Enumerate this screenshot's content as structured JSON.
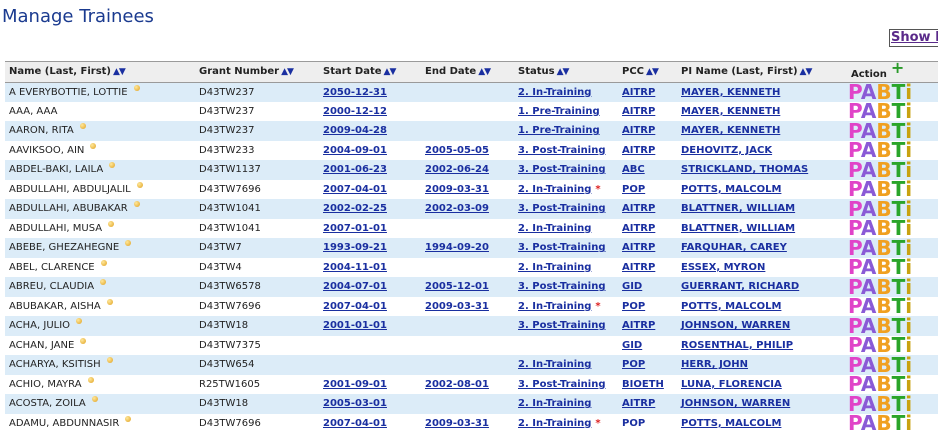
{
  "page": {
    "title": "Manage Trainees",
    "show_link": "Show F"
  },
  "colors": {
    "title": "#1a3a8f",
    "link": "#1a2fa0",
    "row_alt": "#dcecf8",
    "header_bg": "#eeeeee",
    "action_p": "#e044c8",
    "action_a": "#8a5ad6",
    "action_b": "#f0a020",
    "action_t": "#2aa52a"
  },
  "table": {
    "headers": {
      "name": "Name (Last, First)",
      "grant": "Grant Number",
      "start": "Start Date",
      "end": "End Date",
      "status": "Status",
      "pcc": "PCC",
      "pi": "PI Name (Last, First)",
      "action": "Action"
    },
    "sort_icons": {
      "asc": "▲",
      "desc": "▼"
    },
    "add_icon": "+",
    "action_letters": [
      "P",
      "A",
      "B",
      "T",
      "i"
    ],
    "rows": [
      {
        "name": "A EVERYBOTTIE, LOTTIE",
        "dot": true,
        "grant": "D43TW237",
        "start": "2050-12-31",
        "end": "",
        "status": "2. In-Training",
        "star": false,
        "pcc": "AITRP",
        "pcc_link": true,
        "pi": "MAYER, KENNETH"
      },
      {
        "name": "AAA, AAA",
        "dot": false,
        "grant": "D43TW237",
        "start": "2000-12-12",
        "end": "",
        "status": "1. Pre-Training",
        "star": false,
        "pcc": "AITRP",
        "pcc_link": true,
        "pi": "MAYER, KENNETH"
      },
      {
        "name": "AARON, RITA",
        "dot": true,
        "grant": "D43TW237",
        "start": "2009-04-28",
        "end": "",
        "status": "1. Pre-Training",
        "star": false,
        "pcc": "AITRP",
        "pcc_link": true,
        "pi": "MAYER, KENNETH"
      },
      {
        "name": "AAVIKSOO, AIN",
        "dot": true,
        "grant": "D43TW233",
        "start": "2004-09-01",
        "end": "2005-05-05",
        "status": "3. Post-Training",
        "star": false,
        "pcc": "AITRP",
        "pcc_link": true,
        "pi": "DEHOVITZ, JACK"
      },
      {
        "name": "ABDEL-BAKI, LAILA",
        "dot": true,
        "grant": "D43TW1137",
        "start": "2001-06-23",
        "end": "2002-06-24",
        "status": "3. Post-Training",
        "star": false,
        "pcc": "ABC",
        "pcc_link": true,
        "pi": "STRICKLAND, THOMAS"
      },
      {
        "name": "ABDULLAHI, ABDULJALIL",
        "dot": true,
        "grant": "D43TW7696",
        "start": "2007-04-01",
        "end": "2009-03-31",
        "status": "2. In-Training",
        "star": true,
        "pcc": "POP",
        "pcc_link": true,
        "pi": "POTTS, MALCOLM"
      },
      {
        "name": "ABDULLAHI, ABUBAKAR",
        "dot": true,
        "grant": "D43TW1041",
        "start": "2002-02-25",
        "end": "2002-03-09",
        "status": "3. Post-Training",
        "star": false,
        "pcc": "AITRP",
        "pcc_link": true,
        "pi": "BLATTNER, WILLIAM"
      },
      {
        "name": "ABDULLAHI, MUSA",
        "dot": true,
        "grant": "D43TW1041",
        "start": "2007-01-01",
        "end": "",
        "status": "2. In-Training",
        "star": false,
        "pcc": "AITRP",
        "pcc_link": true,
        "pi": "BLATTNER, WILLIAM"
      },
      {
        "name": "ABEBE, GHEZAHEGNE",
        "dot": true,
        "grant": "D43TW7",
        "start": "1993-09-21",
        "end": "1994-09-20",
        "status": "3. Post-Training",
        "star": false,
        "pcc": "AITRP",
        "pcc_link": true,
        "pi": "FARQUHAR, CAREY"
      },
      {
        "name": "ABEL, CLARENCE",
        "dot": true,
        "grant": "D43TW4",
        "start": "2004-11-01",
        "end": "",
        "status": "2. In-Training",
        "star": false,
        "pcc": "AITRP",
        "pcc_link": true,
        "pi": "ESSEX, MYRON"
      },
      {
        "name": "ABREU, CLAUDIA",
        "dot": true,
        "grant": "D43TW6578",
        "start": "2004-07-01",
        "end": "2005-12-01",
        "status": "3. Post-Training",
        "star": false,
        "pcc": "GID",
        "pcc_link": true,
        "pi": "GUERRANT, RICHARD"
      },
      {
        "name": "ABUBAKAR, AISHA",
        "dot": true,
        "grant": "D43TW7696",
        "start": "2007-04-01",
        "end": "2009-03-31",
        "status": "2. In-Training",
        "star": true,
        "pcc": "POP",
        "pcc_link": true,
        "pi": "POTTS, MALCOLM"
      },
      {
        "name": "ACHA, JULIO",
        "dot": true,
        "grant": "D43TW18",
        "start": "2001-01-01",
        "end": "",
        "status": "3. Post-Training",
        "star": false,
        "pcc": "AITRP",
        "pcc_link": true,
        "pi": "JOHNSON, WARREN"
      },
      {
        "name": "ACHAN, JANE",
        "dot": true,
        "grant": "D43TW7375",
        "start": "",
        "end": "",
        "status": "",
        "star": false,
        "pcc": "GID",
        "pcc_link": true,
        "pi": "ROSENTHAL, PHILIP"
      },
      {
        "name": "ACHARYA, KSITISH",
        "dot": true,
        "grant": "D43TW654",
        "start": "",
        "end": "",
        "status": "2. In-Training",
        "star": false,
        "pcc": "POP",
        "pcc_link": true,
        "pi": "HERR, JOHN"
      },
      {
        "name": "ACHIO, MAYRA",
        "dot": true,
        "grant": "R25TW1605",
        "start": "2001-09-01",
        "end": "2002-08-01",
        "status": "3. Post-Training",
        "star": false,
        "pcc": "BIOETH",
        "pcc_link": true,
        "pi": "LUNA, FLORENCIA"
      },
      {
        "name": "ACOSTA, ZOILA",
        "dot": true,
        "grant": "D43TW18",
        "start": "2005-03-01",
        "end": "",
        "status": "2. In-Training",
        "star": false,
        "pcc": "AITRP",
        "pcc_link": true,
        "pi": "JOHNSON, WARREN"
      },
      {
        "name": "ADAMU, ABDUNNASIR",
        "dot": true,
        "grant": "D43TW7696",
        "start": "2007-04-01",
        "end": "2009-03-31",
        "status": "2. In-Training",
        "star": true,
        "pcc": "POP",
        "pcc_link": false,
        "pi": "POTTS, MALCOLM"
      }
    ]
  }
}
